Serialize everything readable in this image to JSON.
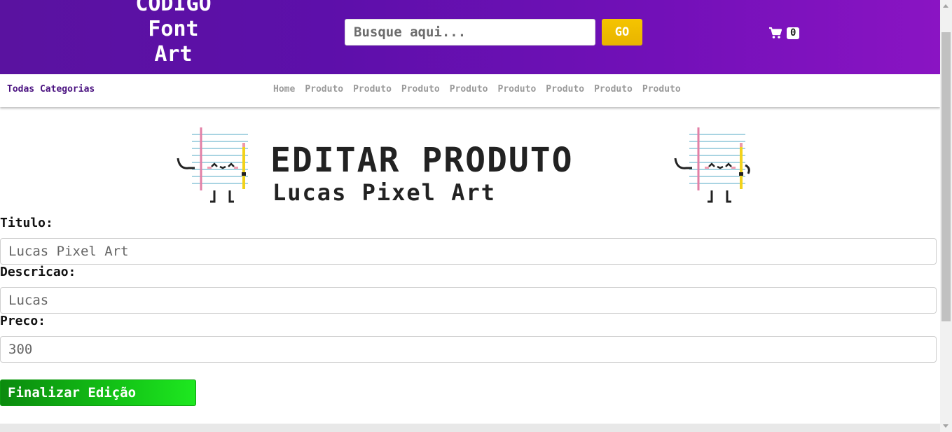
{
  "header": {
    "logo_lines": [
      "CODIGO",
      "Font",
      "Art"
    ],
    "search": {
      "placeholder": "Busque aqui..."
    },
    "go_label": "GO",
    "cart": {
      "icon": "shopping-cart-icon",
      "count": "0"
    }
  },
  "nav": {
    "all_categories": "Todas Categorias",
    "links": [
      "Home",
      "Produto",
      "Produto",
      "Produto",
      "Produto",
      "Produto",
      "Produto",
      "Produto",
      "Produto"
    ]
  },
  "main": {
    "title": "EDITAR PRODUTO",
    "subtitle": "Lucas Pixel Art",
    "mascot_icon": "notebook-mascot-icon"
  },
  "form": {
    "title_label": "Titulo:",
    "title_value": "Lucas Pixel Art",
    "description_label": "Descricao:",
    "description_value": "Lucas",
    "price_label": "Preco:",
    "price_value": "300",
    "submit_label": "Finalizar Edição"
  },
  "colors": {
    "header_start": "#5a12a0",
    "header_end": "#8a14c3",
    "go_button": "#f5c400",
    "submit_button": "#13c316",
    "nav_all_categories": "#4a1280"
  }
}
